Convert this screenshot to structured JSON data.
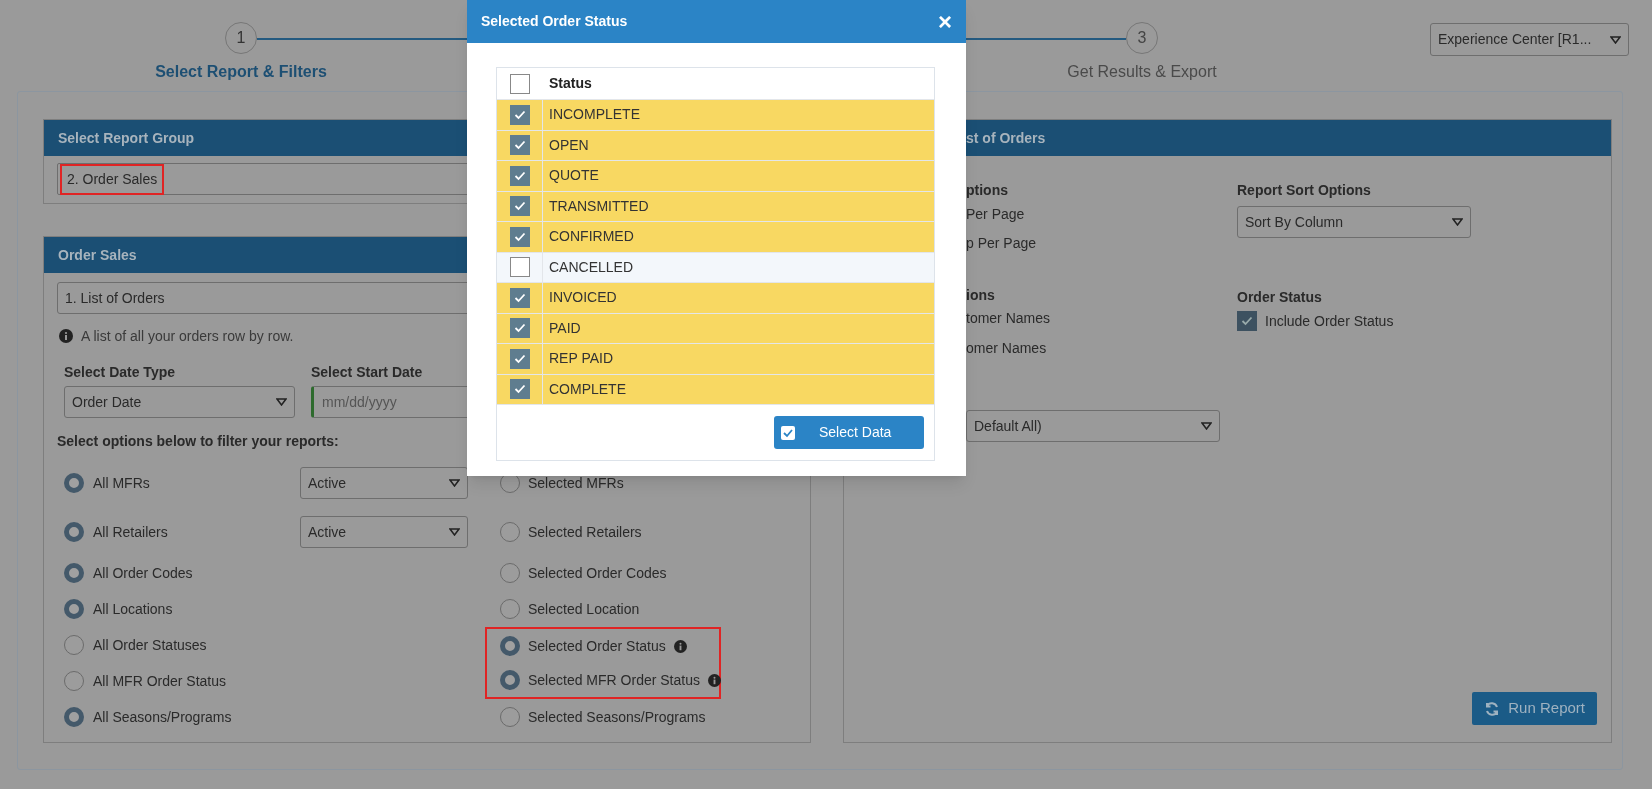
{
  "stepper": {
    "steps": [
      {
        "number": "1",
        "label": "Select Report & Filters",
        "active": true
      },
      {
        "number": "3",
        "label": "Get Results & Export",
        "active": false
      }
    ]
  },
  "location_select": {
    "value": "Experience Center [R1..."
  },
  "report_group_panel": {
    "title": "Select Report Group",
    "value": "2. Order Sales",
    "highlighted": true
  },
  "order_sales_panel": {
    "title": "Order Sales",
    "report_value": "1. List of Orders",
    "info": "A list of all your orders row by row.",
    "date_type": {
      "label": "Select Date Type",
      "value": "Order Date"
    },
    "start_date": {
      "label": "Select Start Date",
      "placeholder": "mm/dd/yyyy"
    },
    "filter_heading": "Select options below to filter your reports:",
    "filters": [
      {
        "left": {
          "label": "All MFRs",
          "selected": true
        },
        "select": "Active",
        "right": {
          "label": "Selected MFRs",
          "selected": false,
          "info": false,
          "highlighted": false
        }
      },
      {
        "left": {
          "label": "All Retailers",
          "selected": true
        },
        "select": "Active",
        "right": {
          "label": "Selected Retailers",
          "selected": false,
          "info": false,
          "highlighted": false
        }
      },
      {
        "left": {
          "label": "All Order Codes",
          "selected": true
        },
        "right": {
          "label": "Selected Order Codes",
          "selected": false,
          "info": false,
          "highlighted": false
        }
      },
      {
        "left": {
          "label": "All Locations",
          "selected": true
        },
        "right": {
          "label": "Selected Location",
          "selected": false,
          "info": false,
          "highlighted": false
        }
      },
      {
        "left": {
          "label": "All Order Statuses",
          "selected": false
        },
        "right": {
          "label": "Selected Order Status",
          "selected": true,
          "info": true,
          "highlighted": true
        }
      },
      {
        "left": {
          "label": "All MFR Order Status",
          "selected": false
        },
        "right": {
          "label": "Selected MFR Order Status",
          "selected": true,
          "info": true,
          "highlighted": true
        }
      },
      {
        "left": {
          "label": "All Seasons/Programs",
          "selected": true
        },
        "right": {
          "label": "Selected Seasons/Programs",
          "selected": false,
          "info": false,
          "highlighted": false
        }
      }
    ]
  },
  "report_panel": {
    "title": "st of Orders",
    "left_column": {
      "heading_1": "ptions",
      "option_1": "Per Page",
      "option_2": "p Per Page",
      "heading_2": "ions",
      "option_3": "tomer Names",
      "option_4": "omer Names",
      "select": "Default All)"
    },
    "sort": {
      "label": "Report Sort Options",
      "value": "Sort By Column"
    },
    "order_status": {
      "label": "Order Status",
      "checkbox_label": "Include Order Status",
      "checked": true
    },
    "run_button": "Run Report"
  },
  "modal": {
    "title": "Selected Order Status",
    "close": "×",
    "column": "Status",
    "all_checked": false,
    "rows": [
      {
        "label": "INCOMPLETE",
        "checked": true
      },
      {
        "label": "OPEN",
        "checked": true
      },
      {
        "label": "QUOTE",
        "checked": true
      },
      {
        "label": "TRANSMITTED",
        "checked": true
      },
      {
        "label": "CONFIRMED",
        "checked": true
      },
      {
        "label": "CANCELLED",
        "checked": false
      },
      {
        "label": "INVOICED",
        "checked": true
      },
      {
        "label": "PAID",
        "checked": true
      },
      {
        "label": "REP PAID",
        "checked": true
      },
      {
        "label": "COMPLETE",
        "checked": true
      }
    ],
    "button": "Select Data"
  }
}
